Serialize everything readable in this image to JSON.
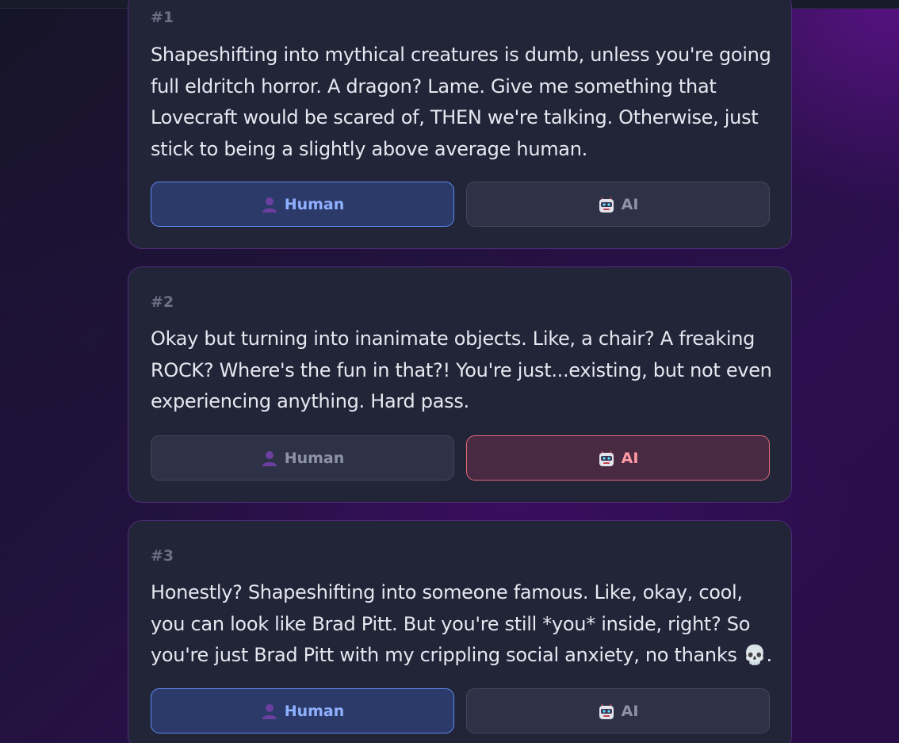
{
  "cards": [
    {
      "number": "#1",
      "text": "Shapeshifting into mythical creatures is dumb, unless you're going full eldritch horror. A dragon? Lame. Give me something that Lovecraft would be scared of, THEN we're talking. Otherwise, just stick to being a slightly above average human.",
      "human_label": "Human",
      "ai_label": "AI",
      "selected": "human"
    },
    {
      "number": "#2",
      "text": "Okay but turning into inanimate objects. Like, a chair? A freaking ROCK? Where's the fun in that?! You're just...existing, but not even experiencing anything. Hard pass.",
      "human_label": "Human",
      "ai_label": "AI",
      "selected": "ai"
    },
    {
      "number": "#3",
      "text": "Honestly? Shapeshifting into someone famous. Like, okay, cool, you can look like Brad Pitt. But you're still *you* inside, right? So you're just Brad Pitt with my crippling social anxiety, no thanks 💀.",
      "human_label": "Human",
      "ai_label": "AI",
      "selected": "human"
    }
  ],
  "icons": {
    "human": "person-silhouette-icon",
    "ai": "robot-face-icon"
  },
  "colors": {
    "human_selected": "#5e8cf0",
    "ai_selected": "#e36a78",
    "card_border": "#4f2b78"
  }
}
